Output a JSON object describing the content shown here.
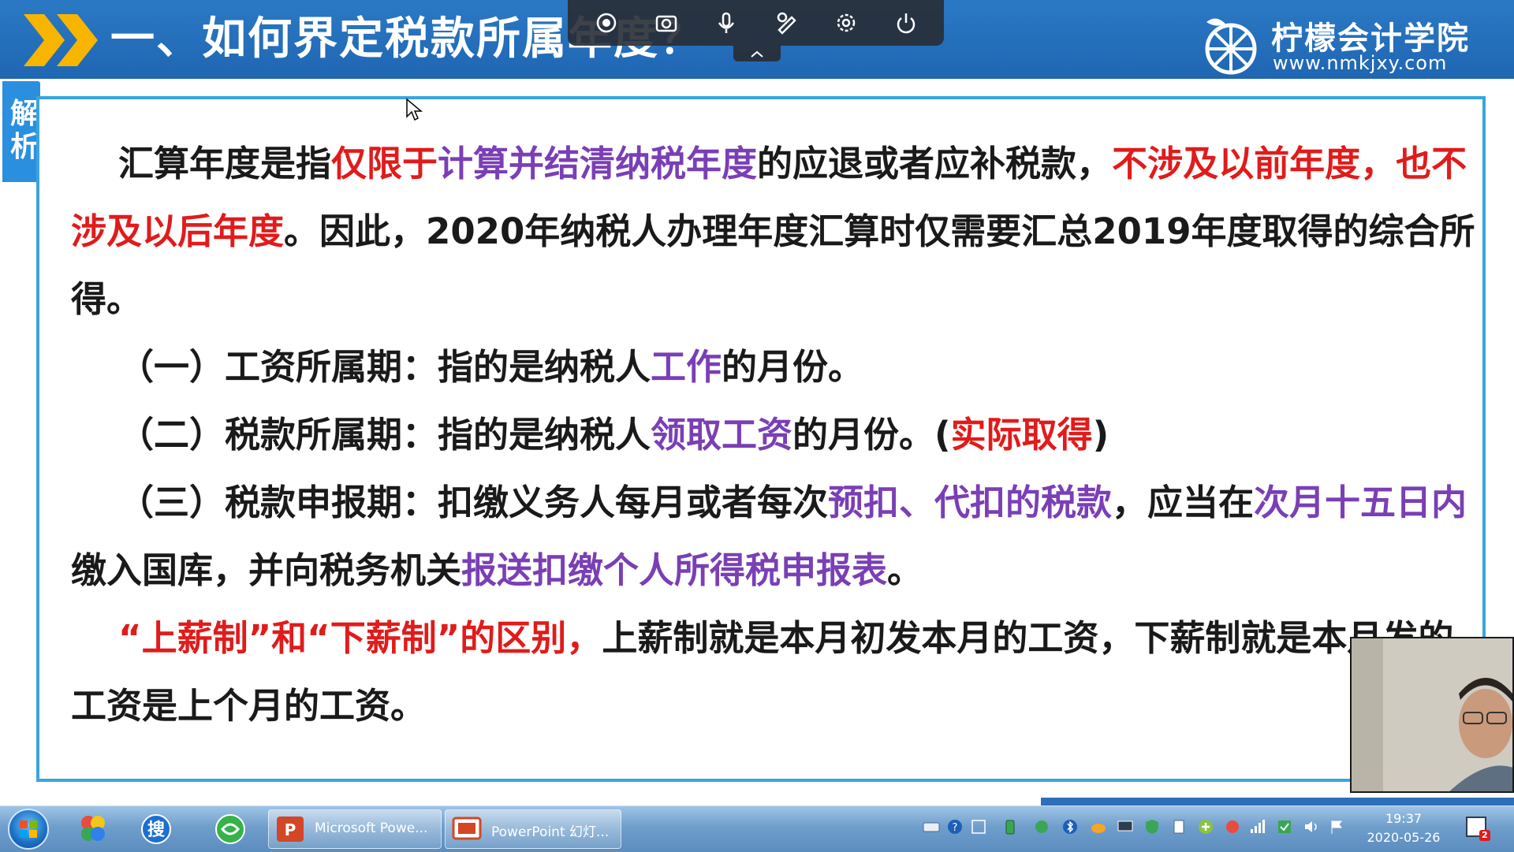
{
  "header": {
    "title": "一、如何界定税款所属年度？",
    "logo_name": "柠檬会计学院",
    "logo_url": "www.nmkjxy.com"
  },
  "recorder_toolbar": {
    "tools": [
      "record-icon",
      "camera-icon",
      "microphone-icon",
      "pen-tool-icon",
      "settings-icon",
      "power-icon"
    ]
  },
  "side_tag": {
    "char1": "解",
    "char2": "析"
  },
  "content": {
    "p1": {
      "s1": "汇算年度是指",
      "s2": "仅限于",
      "s3": "计算并结清纳税年度",
      "s4": "的应退或者应补税款，",
      "s5": "不涉及以前年度，也不涉及以后年度",
      "s6": "。因此，2020年纳税人办理年度汇算时仅需要汇总2019年度取得的综合所得。"
    },
    "p2": {
      "s1": "（一）工资所属期：指的是纳税人",
      "s2": "工作",
      "s3": "的月份。"
    },
    "p3": {
      "s1": "（二）税款所属期：指的是纳税人",
      "s2": "领取工资",
      "s3": "的月份。(",
      "s4": "实际取得",
      "s5": ")"
    },
    "p4": {
      "s1": "（三）税款申报期：扣缴义务人每月或者每次",
      "s2": "预扣、代扣的税款",
      "s3": "，应当在",
      "s4": "次月十五日内",
      "s5": "缴入国库，并向税务机关",
      "s6": "报送扣缴个人所得税申报表",
      "s7": "。"
    },
    "p5": {
      "s1": "“上薪制”和“下薪制”的区别，",
      "s2": "上薪制就是本月初发本月的工资，下薪制就是本月发的工资是上个月的工资。"
    }
  },
  "taskbar": {
    "tasks": [
      {
        "label": "Microsoft Powe...",
        "icon": "powerpoint-icon"
      },
      {
        "label": "PowerPoint 幻灯...",
        "icon": "slideshow-icon"
      }
    ],
    "clock_time": "19:37",
    "clock_date": "2020-05-26",
    "notification_count": "2"
  },
  "colors": {
    "header_blue": "#1f66b3",
    "accent_red": "#e11b1b",
    "accent_purple": "#7a3fb5",
    "frame_blue": "#3aa4e0"
  }
}
